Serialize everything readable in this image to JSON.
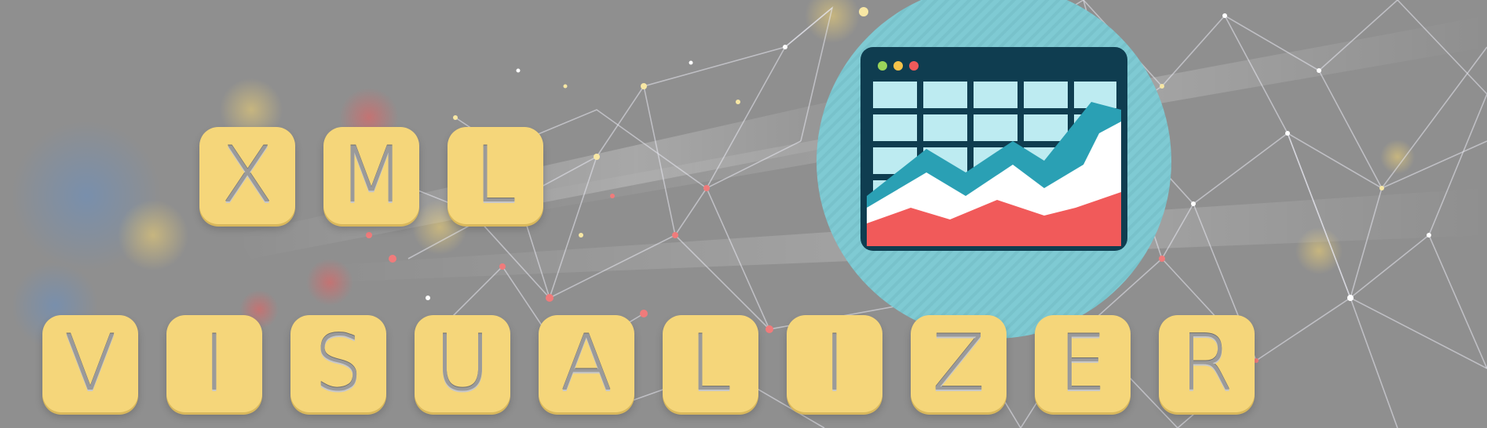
{
  "title": {
    "line1": [
      "X",
      "M",
      "L"
    ],
    "line2": [
      "V",
      "I",
      "S",
      "U",
      "A",
      "L",
      "I",
      "Z",
      "E",
      "R"
    ]
  },
  "icon": {
    "name": "spreadsheet-chart-icon",
    "window_dots": [
      "#9bd45a",
      "#f4c24a",
      "#f15a5a"
    ]
  },
  "colors": {
    "background": "#8f8f8f",
    "tile": "#f5d67a",
    "letter": "#9a9a9a",
    "circle": "#7fcad3",
    "window_frame": "#0f3d50",
    "grid_cell": "#bdebf1",
    "area_red": "#f15a5a",
    "area_teal": "#2aa0b4"
  }
}
